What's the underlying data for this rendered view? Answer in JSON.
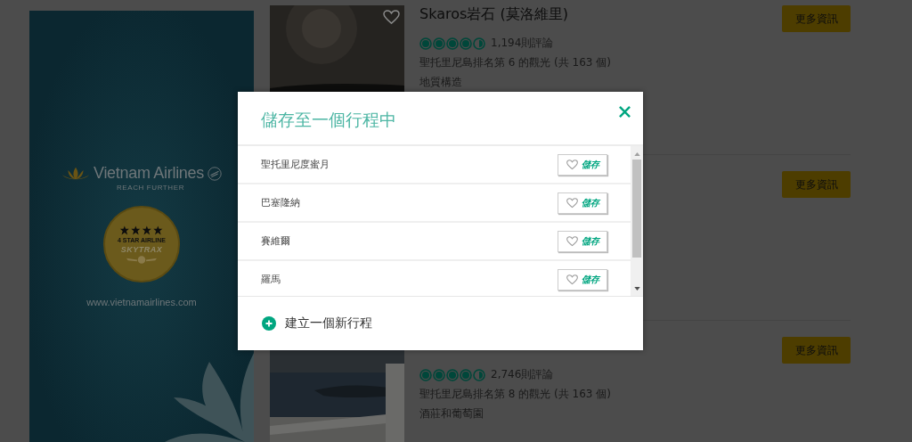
{
  "ad": {
    "brand": "Vietnam Airlines",
    "tagline": "REACH FURTHER",
    "badge_title": "4 STAR AIRLINE",
    "badge_brand": "SKYTRAX",
    "url": "www.vietnamairlines.com"
  },
  "listings": [
    {
      "kind": "full",
      "title": "Skaros岩石 (莫洛維里)",
      "stars": 4.5,
      "reviews": "1,194則評論",
      "rank": "聖托里尼島排名第 6 的觀光 (共 163 個)",
      "category": "地質構造",
      "button": "更多資訊"
    },
    {
      "kind": "covered",
      "button": "更多資訊"
    },
    {
      "kind": "partial",
      "stars": 4.5,
      "reviews": "2,746則評論",
      "rank": "聖托里尼島排名第 8 的觀光 (共 163 個)",
      "category": "酒莊和葡萄園",
      "button": "更多資訊"
    }
  ],
  "modal": {
    "title": "儲存至一個行程中",
    "trips": [
      {
        "name": "聖托里尼度蜜月",
        "save": "儲存"
      },
      {
        "name": "巴塞隆納",
        "save": "儲存"
      },
      {
        "name": "賽維爾",
        "save": "儲存"
      },
      {
        "name": "羅馬",
        "save": "儲存"
      }
    ],
    "create": "建立一個新行程"
  }
}
